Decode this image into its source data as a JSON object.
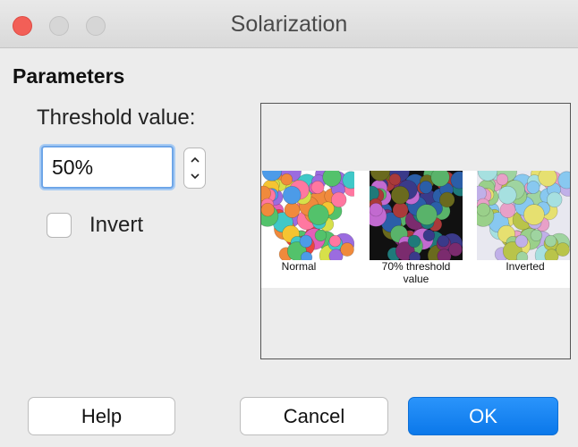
{
  "window": {
    "title": "Solarization"
  },
  "parameters": {
    "heading": "Parameters",
    "threshold_label": "Threshold value:",
    "threshold_value": "50%",
    "invert_label": "Invert",
    "invert_checked": false
  },
  "preview": {
    "captions": {
      "normal": "Normal",
      "threshold_line1": "70% threshold",
      "threshold_line2": "value",
      "inverted": "Inverted"
    }
  },
  "buttons": {
    "help": "Help",
    "cancel": "Cancel",
    "ok": "OK"
  },
  "colors": {
    "accent": "#0b78ea",
    "close": "#f25f57"
  }
}
